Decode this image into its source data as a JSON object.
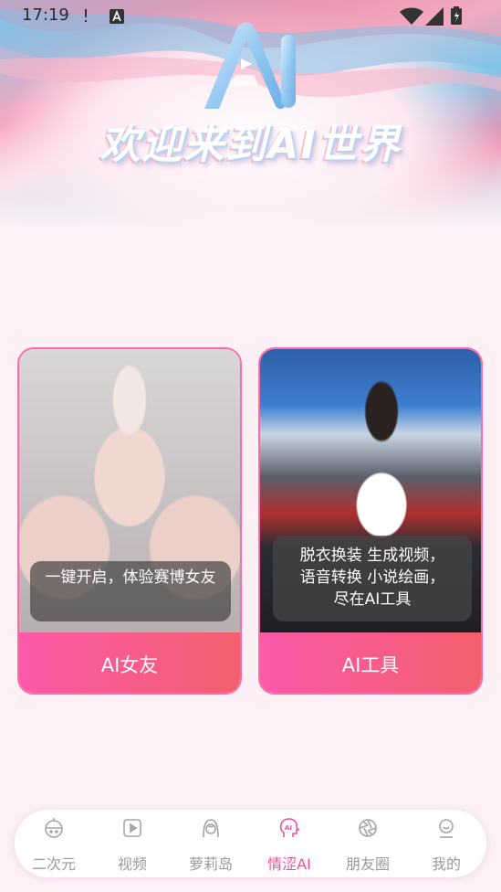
{
  "status_bar": {
    "time": "17:19"
  },
  "header": {
    "logo_text": "AI",
    "welcome_title": "欢迎来到AI世界"
  },
  "cards": [
    {
      "caption": "一键开启，体验赛博女友",
      "label": "AI女友"
    },
    {
      "caption_lines": [
        "脱衣换装 生成视频，",
        "语音转换 小说绘画，",
        "尽在AI工具"
      ],
      "label": "AI工具"
    }
  ],
  "tabs": [
    {
      "label": "二次元",
      "icon": "anime-icon",
      "active": false
    },
    {
      "label": "视频",
      "icon": "video-play-icon",
      "active": false
    },
    {
      "label": "萝莉岛",
      "icon": "girl-face-icon",
      "active": false
    },
    {
      "label": "情涩AI",
      "icon": "ai-head-icon",
      "active": true
    },
    {
      "label": "朋友圈",
      "icon": "aperture-icon",
      "active": false
    },
    {
      "label": "我的",
      "icon": "profile-icon",
      "active": false
    }
  ],
  "colors": {
    "accent": "#ef4f9d",
    "card_gradient_start": "#fb5aa9",
    "card_gradient_end": "#f35f6c",
    "background": "#fdf1f6"
  }
}
